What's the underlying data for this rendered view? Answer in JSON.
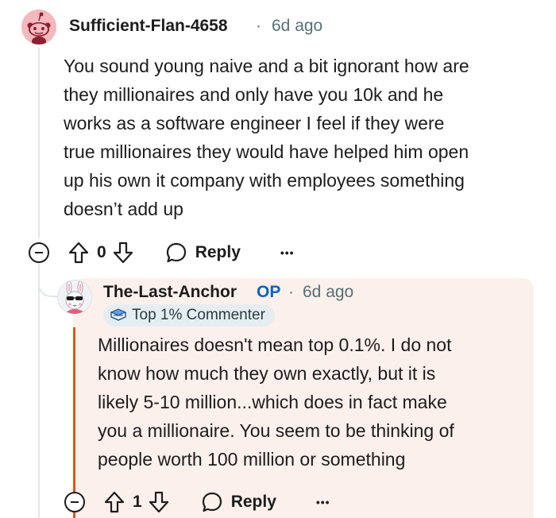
{
  "comment": {
    "author": "Sufficient-Flan-4658",
    "separator": "·",
    "time": "6d ago",
    "lines": [
      "You sound young naive and a bit ignorant how are",
      "they millionaires and only have you 10k and he",
      "works as a software engineer I feel if they were",
      "true millionaires they would have helped him open",
      "up his own it company with employees something",
      "doesn’t add up"
    ],
    "votes": "0",
    "reply_label": "Reply",
    "more_label": "•••"
  },
  "reply": {
    "author": "The-Last-Anchor",
    "op_label": "OP",
    "separator": "·",
    "time": "6d ago",
    "badge": "Top 1% Commenter",
    "lines": [
      "Millionaires doesn't mean top 0.1%. I do not",
      "know how much they own exactly, but it is",
      "likely 5-10 million...which does in fact make",
      "you a millionaire. You seem to be thinking of",
      "people worth 100 million or something"
    ],
    "votes": "1",
    "reply_label": "Reply",
    "more_label": "•••"
  }
}
